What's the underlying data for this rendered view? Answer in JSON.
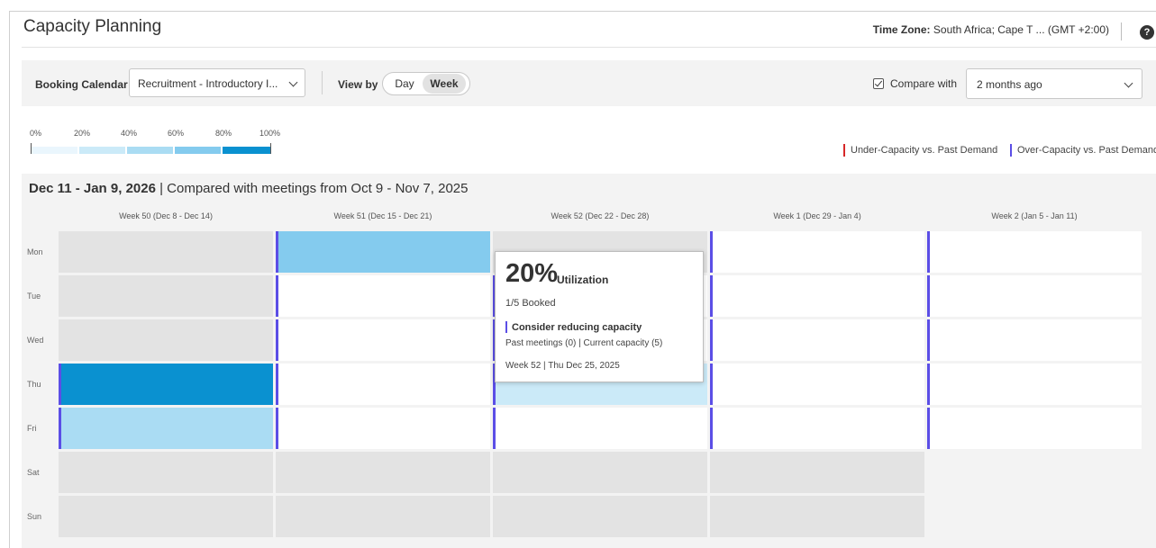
{
  "header": {
    "title": "Capacity Planning",
    "timezone_label": "Time Zone:",
    "timezone_value": " South Africa; Cape T ... (GMT +2:00)",
    "help_glyph": "?"
  },
  "toolbar": {
    "booking_calendar_label": "Booking Calendar",
    "booking_calendar_value": "Recruitment - Introductory I...",
    "view_by_label": "View by",
    "view_day": "Day",
    "view_week": "Week",
    "view_selected": "Week",
    "compare_checked": true,
    "compare_label": "Compare with",
    "compare_value": "2 months ago"
  },
  "scale": {
    "labels": [
      "0%",
      "20%",
      "40%",
      "60%",
      "80%",
      "100%"
    ],
    "colors": [
      "#eaf6fd",
      "#cbeaf8",
      "#aadcf3",
      "#84cbee",
      "#0a91d0"
    ]
  },
  "legend": {
    "under": "Under-Capacity vs. Past Demand",
    "over": "Over-Capacity vs. Past Demand",
    "under_color": "#d62728",
    "over_color": "#5b4ee6"
  },
  "calendar": {
    "range": "Dec 11 - Jan 9, 2026",
    "compare_text": " | Compared with meetings from Oct 9 - Nov 7, 2025",
    "weeks": [
      "Week 50 (Dec 8 - Dec 14)",
      "Week 51 (Dec 15 - Dec 21)",
      "Week 52 (Dec 22 - Dec 28)",
      "Week 1 (Dec 29 - Jan 4)",
      "Week 2 (Jan 5 - Jan 11)"
    ],
    "days": [
      "Mon",
      "Tue",
      "Wed",
      "Thu",
      "Fri",
      "Sat",
      "Sun"
    ]
  },
  "tooltip": {
    "percent": "20%",
    "utilization_label": "Utilization",
    "booked": "1/5 Booked",
    "advice": "Consider reducing capacity",
    "details": "Past meetings (0) | Current capacity (5)",
    "date": "Week 52 | Thu Dec 25, 2025"
  }
}
